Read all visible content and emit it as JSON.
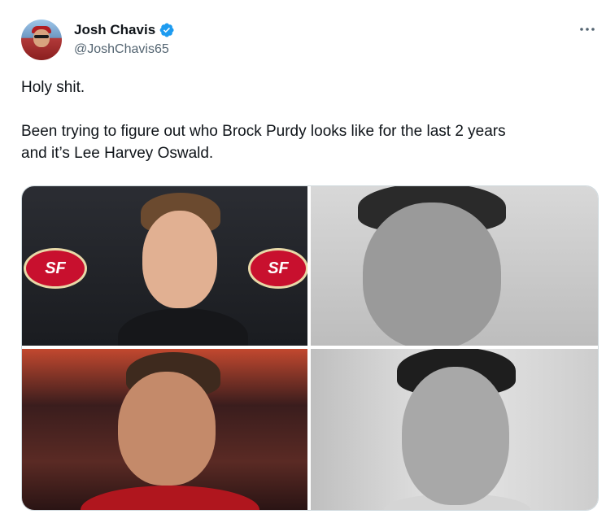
{
  "author": {
    "display_name": "Josh Chavis",
    "handle": "@JoshChavis65",
    "verified": true
  },
  "tweet": {
    "line1": "Holy shit.",
    "line2": "Been trying to figure out who Brock Purdy looks like for the last 2 years",
    "line3": "and it’s Lee Harvey Oswald."
  },
  "media": {
    "photos": [
      {
        "description_icon": "photo"
      },
      {
        "description_icon": "photo"
      },
      {
        "description_icon": "photo"
      },
      {
        "description_icon": "photo"
      }
    ]
  },
  "icons": {
    "verified": "verified-badge-icon",
    "more": "more-icon"
  },
  "colors": {
    "text": "#0f1419",
    "secondary_text": "#536471",
    "verified_blue": "#1d9bf0",
    "border": "#cfd9de"
  }
}
